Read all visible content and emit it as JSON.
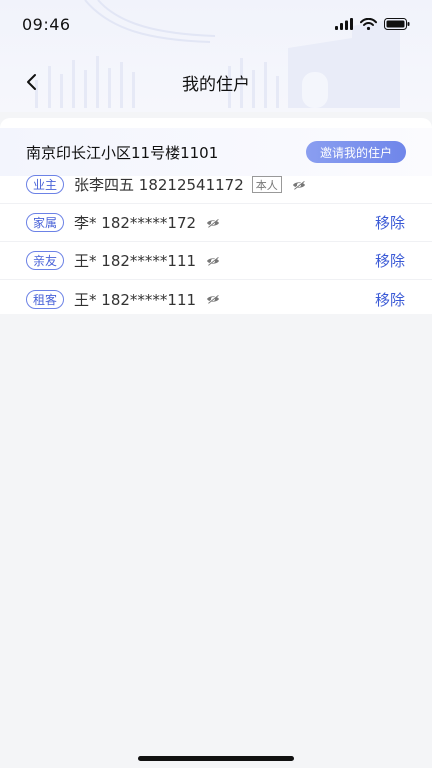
{
  "status_bar": {
    "time": "09:46"
  },
  "nav": {
    "title": "我的住户"
  },
  "address": {
    "text": "南京印长江小区11号楼1101",
    "invite_label": "邀请我的住户"
  },
  "residents": [
    {
      "role": "业主",
      "name_phone": "张李四五 18212541172",
      "self_tag": "本人"
    },
    {
      "role": "家属",
      "name_phone": "李* 182*****172",
      "action": "移除"
    },
    {
      "role": "亲友",
      "name_phone": "王* 182*****111",
      "action": "移除"
    },
    {
      "role": "租客",
      "name_phone": "王* 182*****111",
      "action": "移除"
    }
  ],
  "colors": {
    "accent": "#4a63d8",
    "invite_gradient_start": "#8a9ef0",
    "invite_gradient_end": "#6f86ea",
    "background": "#f4f5f7"
  }
}
